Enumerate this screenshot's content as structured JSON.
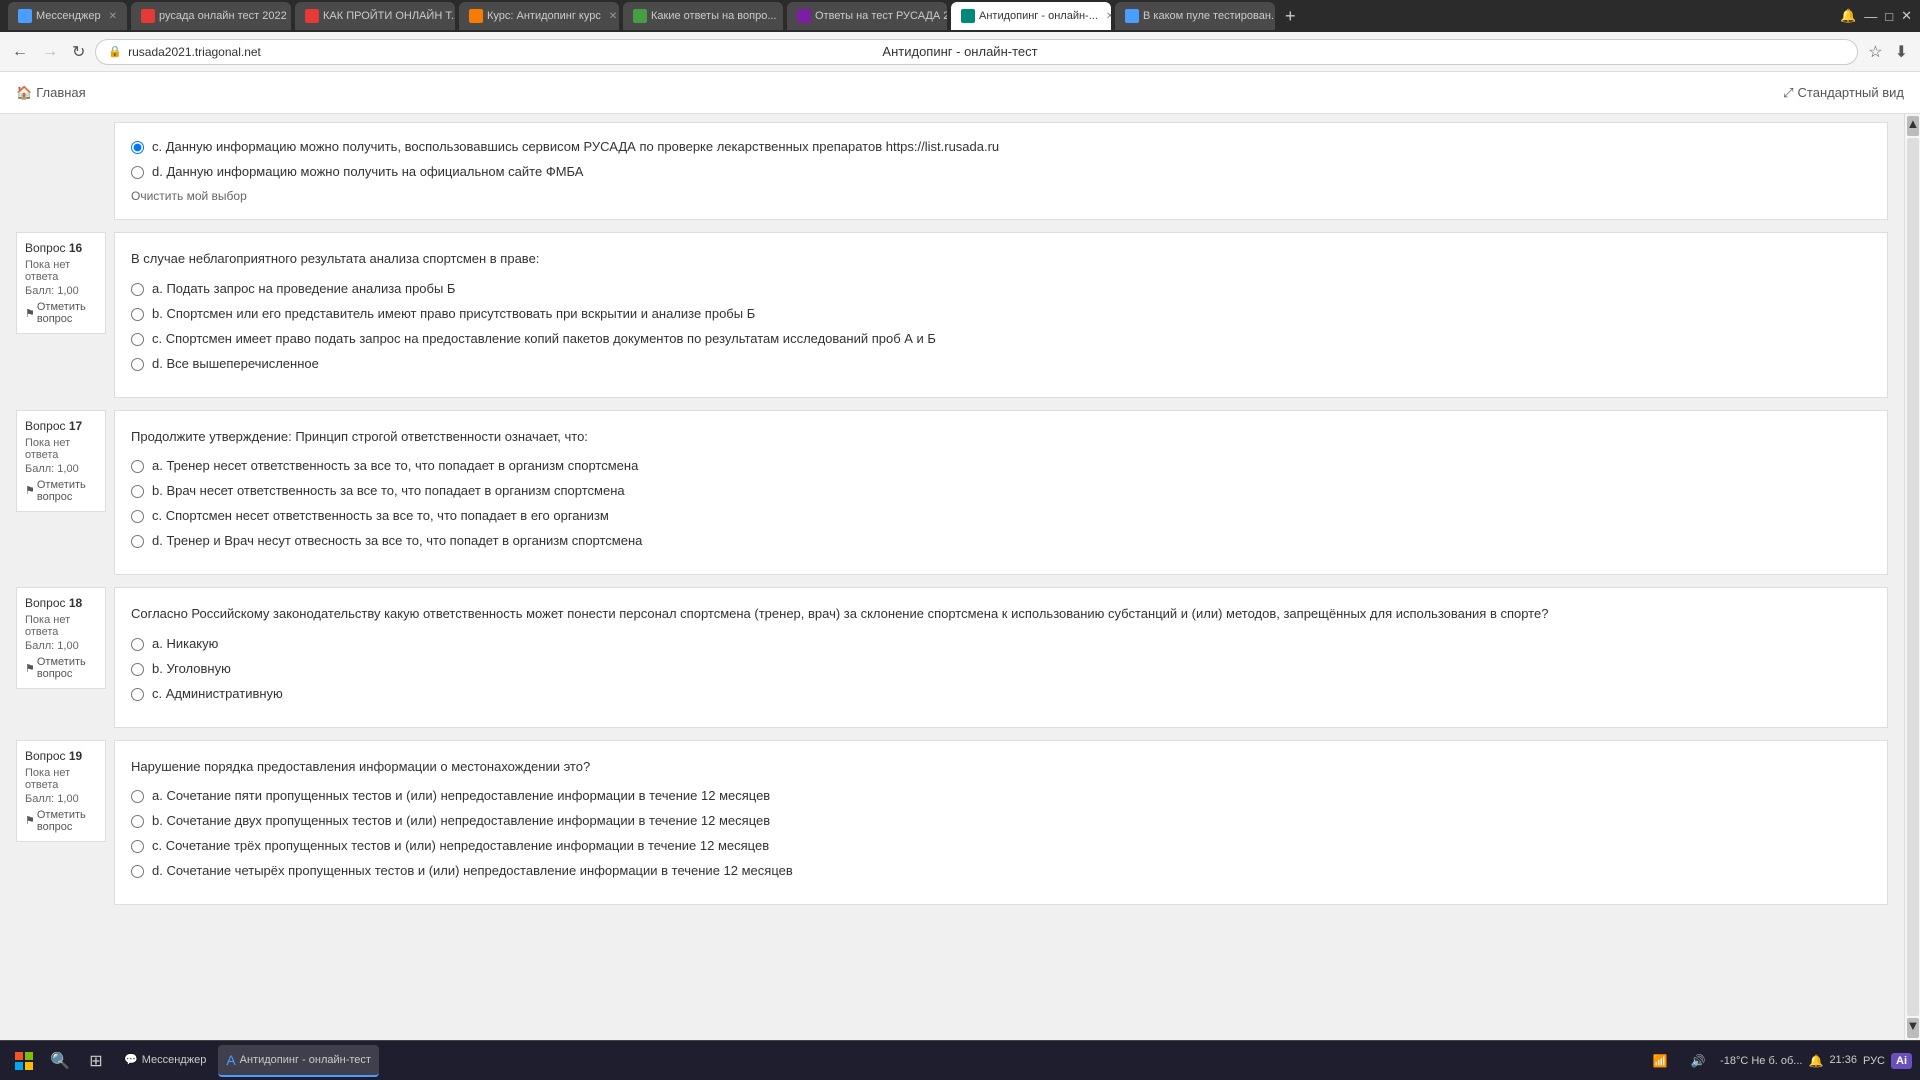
{
  "browser": {
    "tabs": [
      {
        "id": "t1",
        "label": "Мессенджер",
        "favicon_color": "fav-blue",
        "active": false
      },
      {
        "id": "t2",
        "label": "русада онлайн тест 2022",
        "favicon_color": "fav-red",
        "active": false
      },
      {
        "id": "t3",
        "label": "КАК ПРОЙТИ ОНЛАЙН Т...",
        "favicon_color": "fav-red",
        "active": false
      },
      {
        "id": "t4",
        "label": "Курс: Антидопинг курс",
        "favicon_color": "fav-orange",
        "active": false
      },
      {
        "id": "t5",
        "label": "Какие ответы на вопро...",
        "favicon_color": "fav-green",
        "active": false
      },
      {
        "id": "t6",
        "label": "Ответы на тест РУСАДА 2",
        "favicon_color": "fav-purple",
        "active": false
      },
      {
        "id": "t7",
        "label": "Антидопинг - онлайн-...",
        "favicon_color": "fav-teal",
        "active": true
      },
      {
        "id": "t8",
        "label": "В каком пуле тестирован...",
        "favicon_color": "fav-blue",
        "active": false
      }
    ],
    "address": "rusada2021.triagonal.net",
    "page_title": "Антидопинг - онлайн-тест"
  },
  "top_bar": {
    "home_label": "Главная",
    "standard_view_label": "Стандартный вид"
  },
  "questions": [
    {
      "id": "q_prev",
      "show": true,
      "answers": [
        {
          "label": "c. Данную информацию можно получить, воспользовавшись сервисом РУСАДА по проверке лекарственных препаратов https://list.rusada.ru",
          "selected": true
        },
        {
          "label": "d. Данную информацию можно получить на официальном сайте ФМБА",
          "selected": false
        }
      ],
      "clear_label": "Очистить мой выбор"
    },
    {
      "id": "q16",
      "number": "16",
      "status": "Пока нет ответа",
      "score": "Балл: 1,00",
      "flag_label": "Отметить вопрос",
      "text": "В случае неблагоприятного результата анализа спортсмен в праве:",
      "answers": [
        {
          "label": "a. Подать запрос на проведение анализа пробы Б",
          "selected": false
        },
        {
          "label": "b. Спортсмен или его представитель имеют право присутствовать при вскрытии и анализе пробы Б",
          "selected": false
        },
        {
          "label": "c. Спортсмен имеет право подать запрос на предоставление копий пакетов документов по результатам исследований проб А и Б",
          "selected": false
        },
        {
          "label": "d. Все вышеперечисленное",
          "selected": false
        }
      ]
    },
    {
      "id": "q17",
      "number": "17",
      "status": "Пока нет ответа",
      "score": "Балл: 1,00",
      "flag_label": "Отметить вопрос",
      "text": "Продолжите утверждение: Принцип строгой ответственности означает, что:",
      "answers": [
        {
          "label": "a. Тренер несет ответственность за все то, что попадает в организм спортсмена",
          "selected": false
        },
        {
          "label": "b. Врач несет ответственность за все то, что попадает в организм спортсмена",
          "selected": false
        },
        {
          "label": "c. Спортсмен несет ответственность за все то, что попадает в его организм",
          "selected": false
        },
        {
          "label": "d. Тренер и Врач несут отвесность за все то, что попадет в организм спортсмена",
          "selected": false
        }
      ]
    },
    {
      "id": "q18",
      "number": "18",
      "status": "Пока нет ответа",
      "score": "Балл: 1,00",
      "flag_label": "Отметить вопрос",
      "text": "Согласно Российскому законодательству какую ответственность может понести персонал спортсмена (тренер, врач) за склонение спортсмена к использованию субстанций и (или) методов, запрещённых для использования в спорте?",
      "answers": [
        {
          "label": "a. Никакую",
          "selected": false
        },
        {
          "label": "b. Уголовную",
          "selected": false
        },
        {
          "label": "c. Административную",
          "selected": false
        }
      ]
    },
    {
      "id": "q19",
      "number": "19",
      "status": "Пока нет ответа",
      "score": "Балл: 1,00",
      "flag_label": "Отметить вопрос",
      "text": "Нарушение порядка предоставления информации о местонахождении это?",
      "answers": [
        {
          "label": "a. Сочетание пяти пропущенных тестов и (или) непредоставление информации в течение 12 месяцев",
          "selected": false
        },
        {
          "label": "b. Сочетание двух пропущенных тестов и (или) непредоставление информации в течение 12 месяцев",
          "selected": false
        },
        {
          "label": "c. Сочетание трёх пропущенных тестов и (или) непредоставление информации в течение 12 месяцев",
          "selected": false
        },
        {
          "label": "d. Сочетание четырёх пропущенных тестов и (или) непредоставление информации в течение 12 месяцев",
          "selected": false
        }
      ]
    }
  ],
  "taskbar": {
    "apps": [
      {
        "label": "Мессенджер",
        "active": false
      },
      {
        "label": "Антидопинг - онлайн-тест",
        "active": true
      }
    ],
    "system": {
      "temp": "-18°C",
      "weather": "Не б. об...",
      "time": "21:36",
      "lang": "РУС"
    },
    "ai_label": "Ai"
  }
}
